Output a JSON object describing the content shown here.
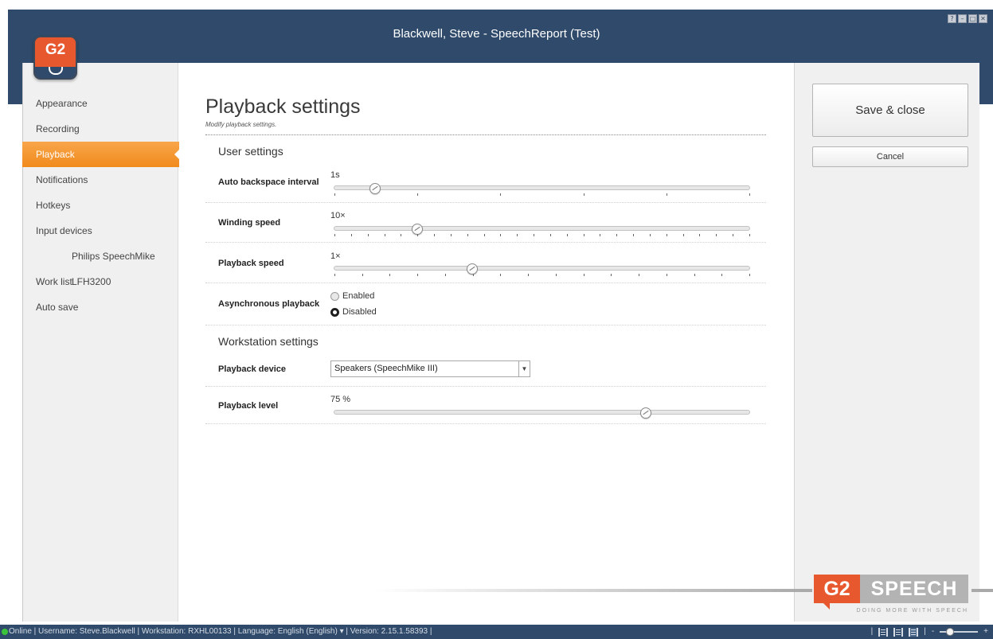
{
  "window": {
    "title": "Blackwell, Steve - SpeechReport (Test)",
    "buttons": [
      "?",
      "–",
      "□",
      "✕"
    ]
  },
  "logo": {
    "text": "G2"
  },
  "sidebar": {
    "items": [
      {
        "label": "Appearance"
      },
      {
        "label": "Recording"
      },
      {
        "label": "Playback",
        "active": true
      },
      {
        "label": "Notifications"
      },
      {
        "label": "Hotkeys"
      },
      {
        "label": "Input devices"
      },
      {
        "label": "Philips SpeechMike LFH3200",
        "sub": true
      },
      {
        "label": "Work list"
      },
      {
        "label": "Auto save"
      }
    ]
  },
  "page": {
    "title": "Playback settings",
    "subtitle": "Modify playback settings."
  },
  "user_settings": {
    "heading": "User settings",
    "auto_backspace": {
      "label": "Auto backspace interval",
      "value_text": "1s",
      "position": 0.1,
      "ticks": 6
    },
    "winding_speed": {
      "label": "Winding speed",
      "value_text": "10×",
      "position": 0.2,
      "ticks": 26
    },
    "playback_speed": {
      "label": "Playback speed",
      "value_text": "1×",
      "position": 0.333,
      "ticks": 16
    },
    "async_playback": {
      "label": "Asynchronous playback",
      "options": [
        {
          "label": "Enabled",
          "checked": false
        },
        {
          "label": "Disabled",
          "checked": true
        }
      ]
    }
  },
  "workstation_settings": {
    "heading": "Workstation settings",
    "playback_device": {
      "label": "Playback device",
      "selected": "Speakers (SpeechMike III)"
    },
    "playback_level": {
      "label": "Playback level",
      "value_text": "75 %",
      "position": 0.75
    }
  },
  "actions": {
    "save_label": "Save & close",
    "cancel_label": "Cancel"
  },
  "brand": {
    "g2": "G2",
    "speech": "SPEECH",
    "tagline": "DOING MORE WITH SPEECH"
  },
  "statusbar": {
    "text": "Online | Username: Steve.Blackwell | Workstation: RXHL00133 | Language:  English (English) ▾  | Version: 2.15.1.58393 |",
    "zoom_minus": "-",
    "zoom_plus": "+",
    "zoom_position": 0.2
  },
  "colors": {
    "titlebar": "#2f4a6a",
    "accent": "#f18a1c",
    "brand_orange": "#e8582e",
    "status_online": "#3bc43b"
  }
}
